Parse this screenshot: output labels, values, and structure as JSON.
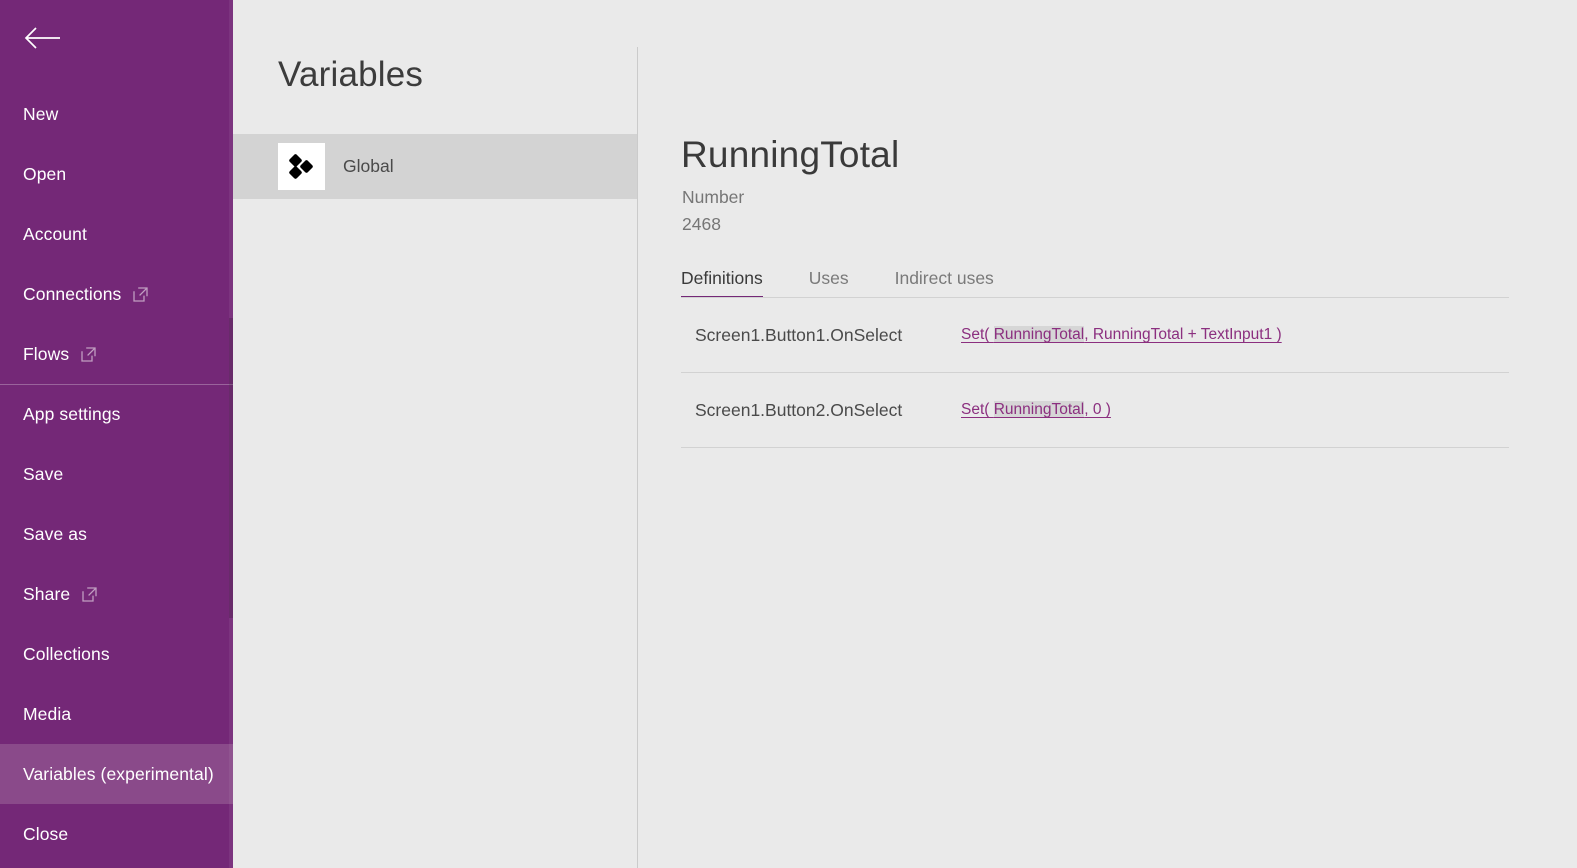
{
  "colors": {
    "sidebar_purple": "#742877",
    "sidebar_selected_purple": "#8a4a8a",
    "page_background": "#eaeaea",
    "list_selected_gray": "#d3d3d3",
    "accent_link_purple": "#8b2f7f",
    "divider_gray": "#d2d2d2"
  },
  "sidebar": {
    "back_icon": "back-arrow-icon",
    "items": [
      {
        "label": "New",
        "external": false,
        "selected": false,
        "divider_before": false
      },
      {
        "label": "Open",
        "external": false,
        "selected": false,
        "divider_before": false
      },
      {
        "label": "Account",
        "external": false,
        "selected": false,
        "divider_before": false
      },
      {
        "label": "Connections",
        "external": true,
        "selected": false,
        "divider_before": false
      },
      {
        "label": "Flows",
        "external": true,
        "selected": false,
        "divider_before": false
      },
      {
        "label": "App settings",
        "external": false,
        "selected": false,
        "divider_before": true
      },
      {
        "label": "Save",
        "external": false,
        "selected": false,
        "divider_before": false
      },
      {
        "label": "Save as",
        "external": false,
        "selected": false,
        "divider_before": false
      },
      {
        "label": "Share",
        "external": true,
        "selected": false,
        "divider_before": false
      },
      {
        "label": "Collections",
        "external": false,
        "selected": false,
        "divider_before": false
      },
      {
        "label": "Media",
        "external": false,
        "selected": false,
        "divider_before": false
      },
      {
        "label": "Variables (experimental)",
        "external": false,
        "selected": true,
        "divider_before": false
      },
      {
        "label": "Close",
        "external": false,
        "selected": false,
        "divider_before": false
      }
    ],
    "external_icon": "open-in-new-window-icon"
  },
  "variables_panel": {
    "title": "Variables",
    "items": [
      {
        "label": "Global",
        "icon": "global-variable-icon",
        "selected": true
      }
    ]
  },
  "detail": {
    "name": "RunningTotal",
    "type": "Number",
    "value": "2468",
    "tabs": [
      {
        "label": "Definitions",
        "active": true
      },
      {
        "label": "Uses",
        "active": false
      },
      {
        "label": "Indirect uses",
        "active": false
      }
    ],
    "rows": [
      {
        "source": "Screen1.Button1.OnSelect",
        "formula_prefix": "Set( ",
        "formula_highlight": "RunningTotal",
        "formula_suffix": ", RunningTotal + TextInput1 )"
      },
      {
        "source": "Screen1.Button2.OnSelect",
        "formula_prefix": "Set( ",
        "formula_highlight": "RunningTotal",
        "formula_suffix": ", 0 )"
      }
    ]
  }
}
